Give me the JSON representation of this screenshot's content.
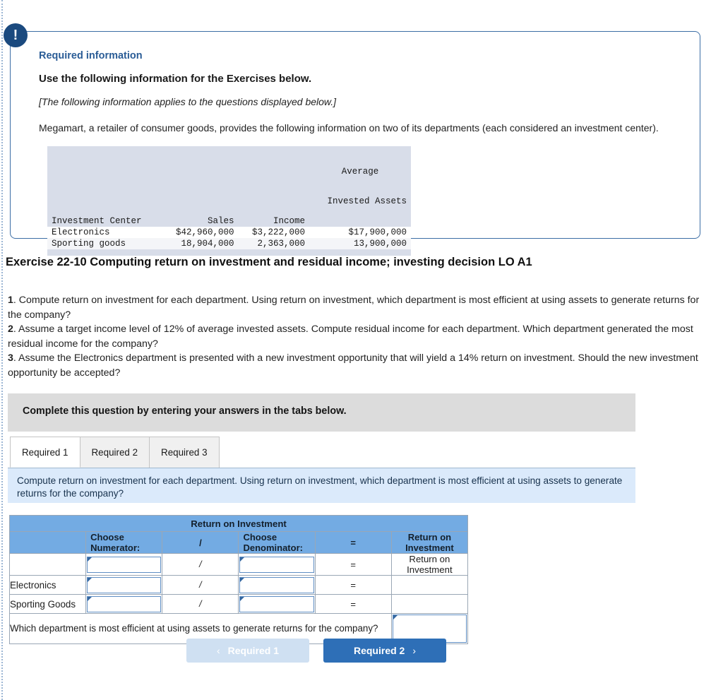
{
  "info_box": {
    "badge_icon": "exclamation-icon",
    "badge_glyph": "!",
    "required_information_label": "Required information",
    "heading": "Use the following information for the Exercises below.",
    "applies_note": "[The following information applies to the questions displayed below.]",
    "intro_paragraph": "Megamart, a retailer of consumer goods, provides the following information on two of its departments (each considered an investment center).",
    "data_table": {
      "headers": {
        "col1": "Investment Center",
        "col2": "Sales",
        "col3": "Income",
        "col4_top": "Average",
        "col4_bottom": "Invested Assets"
      },
      "rows": [
        {
          "center": "Electronics",
          "sales": "$42,960,000",
          "income": "$3,222,000",
          "avg_invested_assets": "$17,900,000"
        },
        {
          "center": "Sporting goods",
          "sales": "18,904,000",
          "income": "2,363,000",
          "avg_invested_assets": "13,900,000"
        }
      ]
    }
  },
  "exercise": {
    "title": "Exercise 22-10 Computing return on investment and residual income; investing decision LO A1",
    "questions": [
      {
        "number": "1",
        "text": ". Compute return on investment for each department. Using return on investment, which department is most efficient at using assets to generate returns for the company?"
      },
      {
        "number": "2",
        "text": ". Assume a target income level of 12% of average invested assets. Compute residual income for each department. Which department generated the most residual income for the company?"
      },
      {
        "number": "3",
        "text": ". Assume the Electronics department is presented with a new investment opportunity that will yield a 14% return on investment. Should the new investment opportunity be accepted?"
      }
    ]
  },
  "instruction_band": {
    "text": "Complete this question by entering your answers in the tabs below."
  },
  "tabs": [
    {
      "label": "Required 1",
      "active": true
    },
    {
      "label": "Required 2",
      "active": false
    },
    {
      "label": "Required 3",
      "active": false
    }
  ],
  "question_band": {
    "text": "Compute return on investment for each department. Using return on investment, which department is most efficient at using assets to generate returns for the company?"
  },
  "answer_table": {
    "title": "Return on Investment",
    "headers": {
      "blank": "",
      "numerator": "Choose Numerator:",
      "slash": "/",
      "denominator": "Choose Denominator:",
      "equals": "=",
      "result": "Return on Investment"
    },
    "rows": [
      {
        "label": "",
        "slash": "/",
        "equals": "=",
        "result": "Return on Investment"
      },
      {
        "label": "Electronics",
        "slash": "/",
        "equals": "=",
        "result": ""
      },
      {
        "label": "Sporting Goods",
        "slash": "/",
        "equals": "=",
        "result": ""
      }
    ],
    "final_question": "Which department is most efficient at using assets to generate returns for the company?"
  },
  "footer_nav": {
    "prev_label": "Required 1",
    "prev_chevron": "‹",
    "next_label": "Required 2",
    "next_chevron": "›"
  },
  "colors": {
    "accent_blue": "#2e6fb7",
    "table_header_blue": "#73abe3",
    "question_band_blue": "#dbeafb",
    "instruction_gray": "#dcdcdc",
    "badge_navy": "#1b4a7f"
  }
}
